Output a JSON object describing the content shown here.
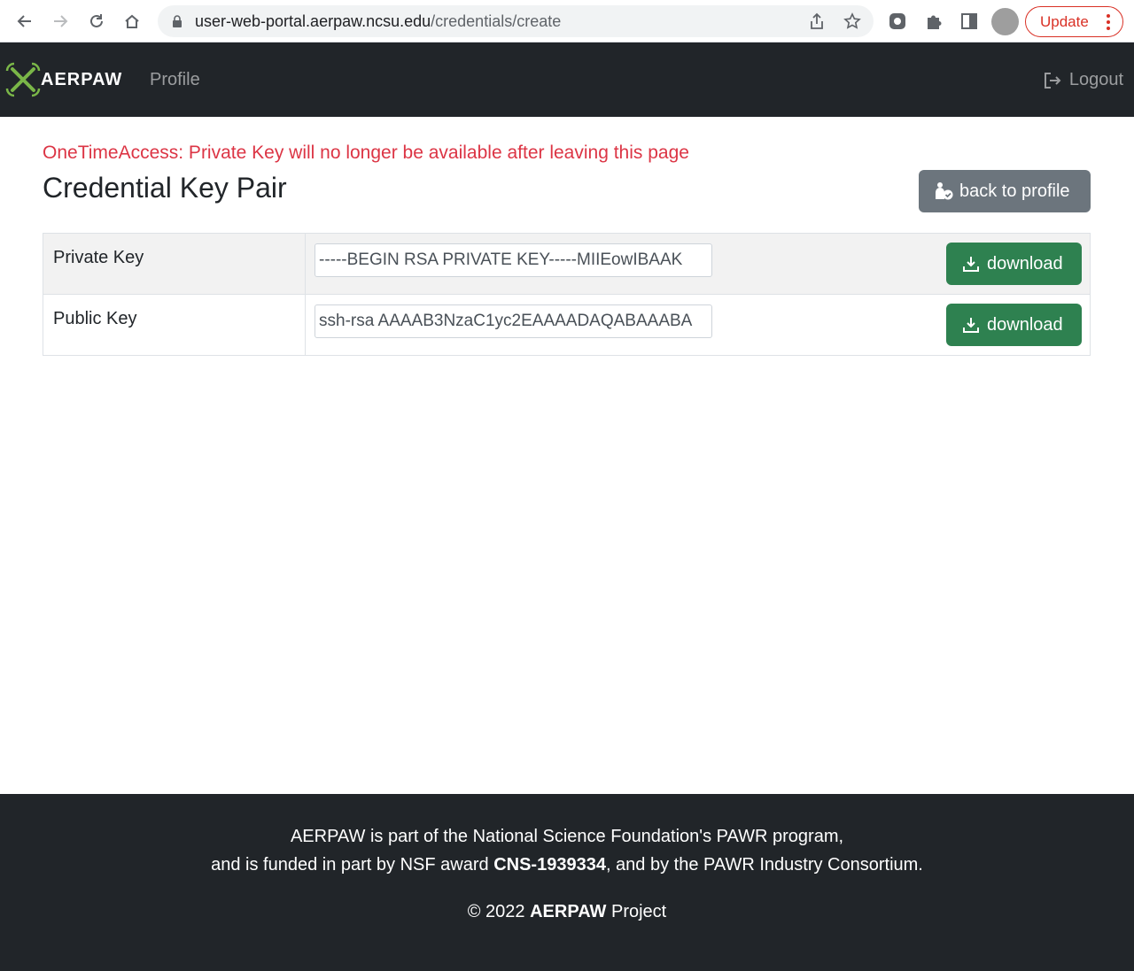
{
  "browser": {
    "url_host": "user-web-portal.aerpaw.ncsu.edu",
    "url_path": "/credentials/create",
    "update_label": "Update"
  },
  "navbar": {
    "logo_text": "AERPAW",
    "profile_link": "Profile",
    "logout_link": "Logout"
  },
  "main": {
    "alert": "OneTimeAccess: Private Key will no longer be available after leaving this page",
    "title": "Credential Key Pair",
    "back_button": "back to profile",
    "rows": [
      {
        "label": "Private Key",
        "value": "-----BEGIN RSA PRIVATE KEY-----MIIEowIBAAK",
        "button": "download"
      },
      {
        "label": "Public Key",
        "value": "ssh-rsa AAAAB3NzaC1yc2EAAAADAQABAAABA",
        "button": "download"
      }
    ]
  },
  "footer": {
    "line1": "AERPAW is part of the National Science Foundation's PAWR program,",
    "line2_pre": "and is funded in part by NSF award ",
    "line2_award": "CNS-1939334",
    "line2_post": ", and by the PAWR Industry Consortium.",
    "line3_pre": "© 2022 ",
    "line3_bold": "AERPAW",
    "line3_post": " Project"
  },
  "colors": {
    "navbar_bg": "#212529",
    "alert_red": "#dc3545",
    "download_green": "#2e8150",
    "secondary_gray": "#6c757d",
    "logo_green": "#7ab648"
  },
  "icons": [
    "back-arrow-icon",
    "forward-arrow-icon",
    "reload-icon",
    "home-icon",
    "lock-icon",
    "share-icon",
    "star-icon",
    "extension-app-icon",
    "puzzle-icon",
    "side-panel-icon",
    "logout-icon",
    "person-check-icon",
    "download-icon"
  ]
}
